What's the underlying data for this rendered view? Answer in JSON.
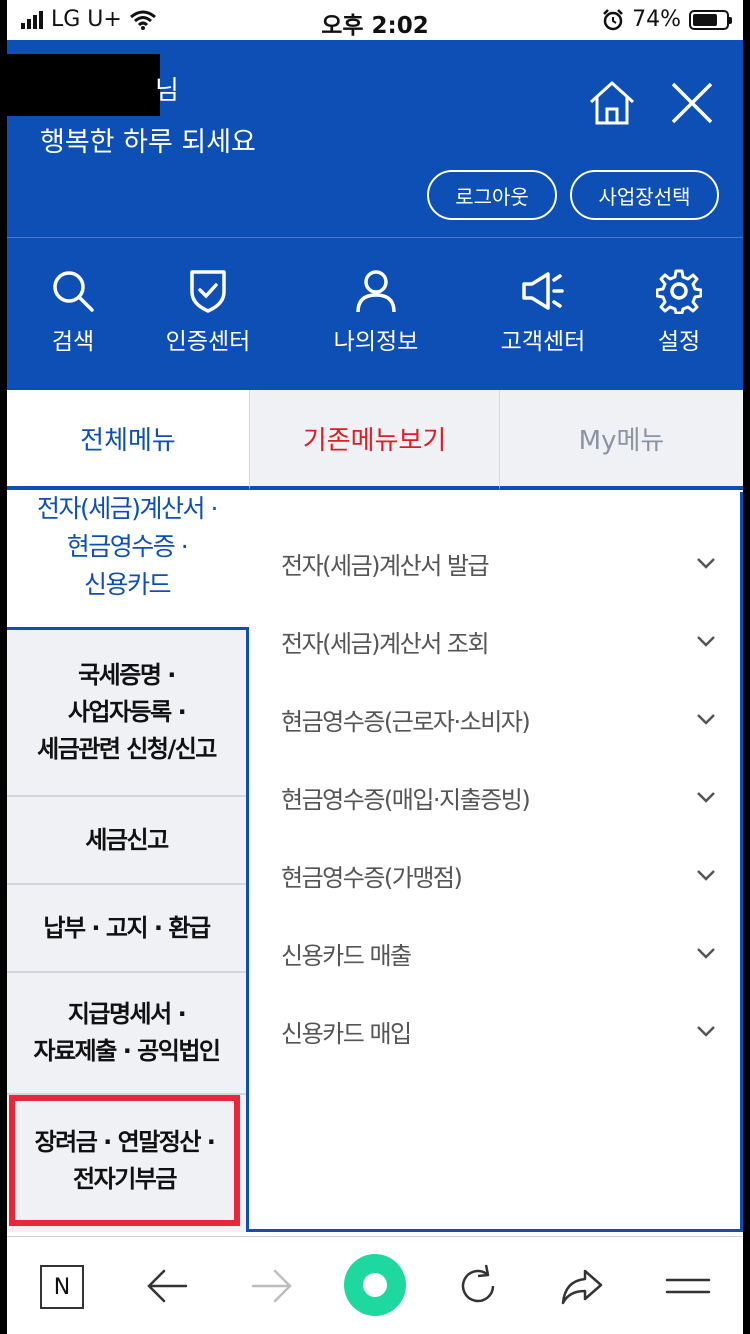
{
  "status_bar": {
    "carrier": "LG U+",
    "time": "오후 2:02",
    "battery": "74%",
    "battery_level": 0.74
  },
  "header": {
    "name_suffix": "님",
    "greeting": "행복한 하루 되세요",
    "logout_label": "로그아웃",
    "workplace_label": "사업장선택",
    "quick_menu": [
      {
        "label": "검색",
        "icon": "search-icon"
      },
      {
        "label": "인증센터",
        "icon": "shield-check-icon"
      },
      {
        "label": "나의정보",
        "icon": "user-icon"
      },
      {
        "label": "고객센터",
        "icon": "megaphone-icon"
      },
      {
        "label": "설정",
        "icon": "gear-icon"
      }
    ]
  },
  "tabs": {
    "all": "전체메뉴",
    "legacy": "기존메뉴보기",
    "my": "My메뉴"
  },
  "categories": [
    {
      "lines": [
        "전자(세금)계산서 ·",
        "현금영수증 ·",
        "신용카드"
      ],
      "active": true
    },
    {
      "lines": [
        "국세증명 ·",
        "사업자등록 ·",
        "세금관련 신청/신고"
      ]
    },
    {
      "lines": [
        "세금신고"
      ]
    },
    {
      "lines": [
        "납부 · 고지 · 환급"
      ]
    },
    {
      "lines": [
        "지급명세서 ·",
        "자료제출 · 공익법인"
      ]
    },
    {
      "lines": [
        "장려금 · 연말정산 ·",
        "전자기부금"
      ],
      "highlighted": true
    }
  ],
  "sub_items": [
    "전자(세금)계산서 발급",
    "전자(세금)계산서 조회",
    "현금영수증(근로자·소비자)",
    "현금영수증(매입·지출증빙)",
    "현금영수증(가맹점)",
    "신용카드 매출",
    "신용카드 매입"
  ],
  "toolbar": {
    "n_label": "N"
  },
  "colors": {
    "brand_blue": "#0e4fb6",
    "legacy_red": "#e21c23",
    "highlight_red": "#e8283a",
    "accent_green": "#1fd8a0"
  }
}
